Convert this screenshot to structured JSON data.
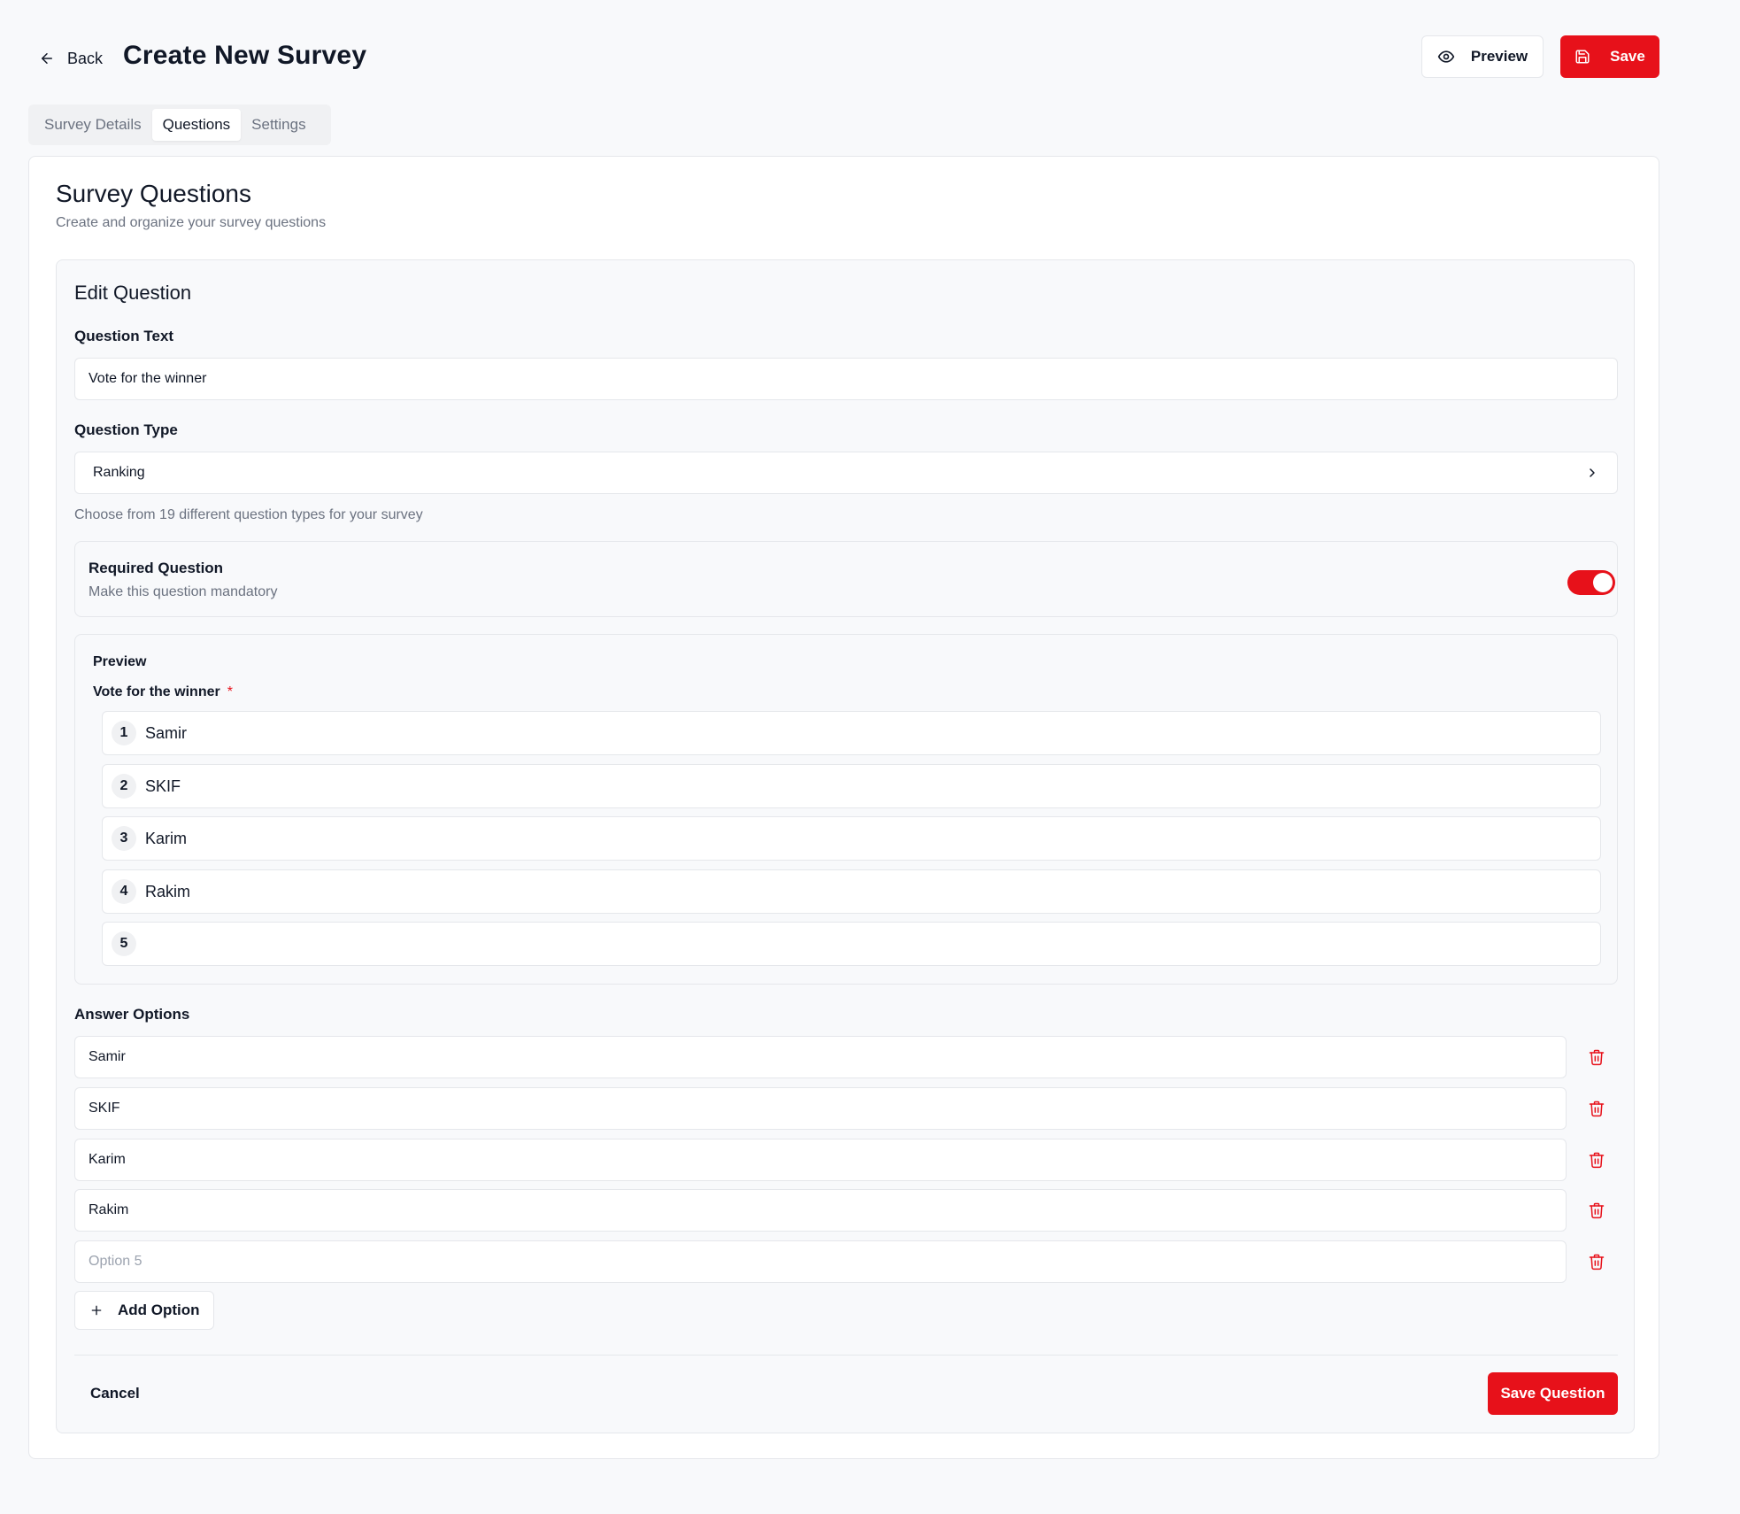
{
  "header": {
    "back_label": "Back",
    "title": "Create New Survey",
    "preview_label": "Preview",
    "save_label": "Save"
  },
  "tabs": [
    {
      "label": "Survey Details",
      "active": false
    },
    {
      "label": "Questions",
      "active": true
    },
    {
      "label": "Settings",
      "active": false
    }
  ],
  "section": {
    "title": "Survey Questions",
    "subtitle": "Create and organize your survey questions"
  },
  "editor": {
    "title": "Edit Question",
    "question_text_label": "Question Text",
    "question_text_value": "Vote for the winner",
    "question_type_label": "Question Type",
    "question_type_value": "Ranking",
    "question_type_helper": "Choose from 19 different question types for your survey",
    "required": {
      "title": "Required Question",
      "subtitle": "Make this question mandatory",
      "enabled": true
    },
    "preview": {
      "label": "Preview",
      "question": "Vote for the winner",
      "required_mark": "*",
      "items": [
        {
          "num": "1",
          "text": "Samir"
        },
        {
          "num": "2",
          "text": "SKIF"
        },
        {
          "num": "3",
          "text": "Karim"
        },
        {
          "num": "4",
          "text": "Rakim"
        },
        {
          "num": "5",
          "text": ""
        }
      ]
    },
    "answer_options_label": "Answer Options",
    "options": [
      {
        "value": "Samir",
        "placeholder": ""
      },
      {
        "value": "SKIF",
        "placeholder": ""
      },
      {
        "value": "Karim",
        "placeholder": ""
      },
      {
        "value": "Rakim",
        "placeholder": ""
      },
      {
        "value": "",
        "placeholder": "Option 5"
      }
    ],
    "add_option_label": "Add Option",
    "cancel_label": "Cancel",
    "save_question_label": "Save Question"
  },
  "colors": {
    "accent": "#e7111a",
    "background": "#f8f9fb",
    "border": "#e5e7eb",
    "text": "#111827",
    "muted_text": "#6b7280"
  },
  "icons": {
    "back": "arrow-left-icon",
    "preview": "eye-icon",
    "save": "save-icon",
    "select": "chevron-right-icon",
    "delete": "trash-icon",
    "add": "plus-icon"
  }
}
